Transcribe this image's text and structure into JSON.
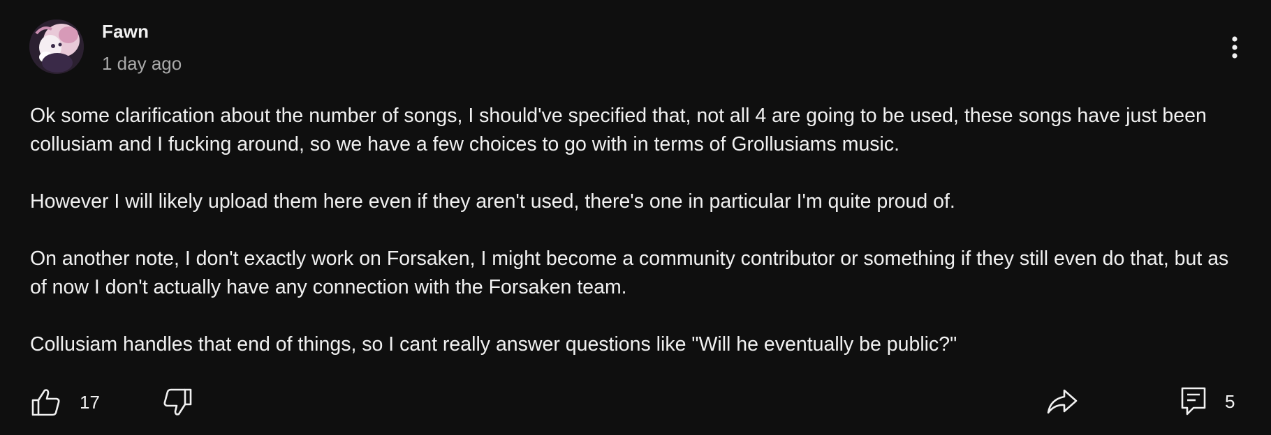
{
  "comment": {
    "author": "Fawn",
    "timestamp": "1 day ago",
    "paragraphs": [
      "Ok some clarification about the number of songs, I should've specified that, not all 4 are going to be used, these songs have just been collusiam and I fucking around, so we have a few choices to go with in terms of Grollusiams music.",
      "However I will likely upload them here even if they aren't used, there's one in particular I'm quite proud of.",
      "On another note, I don't exactly work on Forsaken, I might become a community contributor or something if they still even do that, but as of now I don't actually have any connection with the Forsaken team.",
      "Collusiam handles that end of things, so I cant really answer questions like \"Will he eventually be public?\""
    ]
  },
  "actions": {
    "like_count": "17",
    "reply_count": "5"
  },
  "icons": {
    "menu": "more-vertical-icon",
    "like": "thumbs-up-icon",
    "dislike": "thumbs-down-icon",
    "share": "share-arrow-icon",
    "replies": "comment-icon"
  },
  "colors": {
    "background": "#0f0f0f",
    "text": "#f1f1f1",
    "secondary_text": "#aaaaaa"
  }
}
